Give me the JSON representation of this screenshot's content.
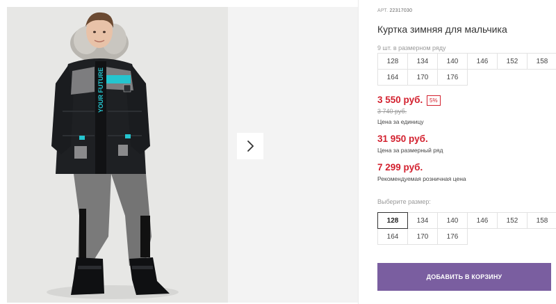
{
  "product": {
    "article_label": "АРТ.",
    "article": "22317030",
    "title": "Куртка зимняя для мальчика",
    "pack_note": "9 шт. в размерном ряду",
    "pack_sizes": [
      "128",
      "134",
      "140",
      "146",
      "152",
      "158",
      "164",
      "170",
      "176"
    ],
    "price_main": "3 550 руб.",
    "discount_badge": "5%",
    "price_old": "3 740 руб.",
    "price_unit_label": "Цена за единицу",
    "price_pack": "31 950 руб.",
    "price_pack_label": "Цена за размерный ряд",
    "price_retail": "7 299 руб.",
    "price_retail_label": "Рекомендуемая розничная цена",
    "choose_size_label": "Выберите размер:",
    "select_sizes": [
      "128",
      "134",
      "140",
      "146",
      "152",
      "158",
      "164",
      "170",
      "176"
    ],
    "selected_size": "128",
    "add_to_cart": "ДОБАВИТЬ В КОРЗИНУ"
  },
  "gallery": {
    "photo_print_text": "YOUR FUTURE",
    "next_icon": "chevron-right-icon"
  },
  "colors": {
    "price_red": "#d3202e",
    "button_purple": "#7a5ea0",
    "jacket_black": "#1d1f22",
    "jacket_accent": "#25c5cf",
    "pants_grey": "#7d7d7d"
  }
}
